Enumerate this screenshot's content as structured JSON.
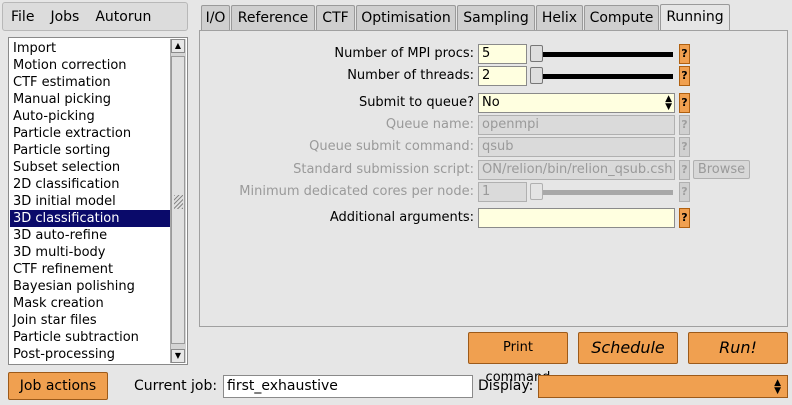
{
  "menu": {
    "file": "File",
    "jobs": "Jobs",
    "autorun": "Autorun"
  },
  "job_types": [
    "Import",
    "Motion correction",
    "CTF estimation",
    "Manual picking",
    "Auto-picking",
    "Particle extraction",
    "Particle sorting",
    "Subset selection",
    "2D classification",
    "3D initial model",
    "3D classification",
    "3D auto-refine",
    "3D multi-body",
    "CTF refinement",
    "Bayesian polishing",
    "Mask creation",
    "Join star files",
    "Particle subtraction",
    "Post-processing"
  ],
  "selected_job_type": "3D classification",
  "tabs": [
    "I/O",
    "Reference",
    "CTF",
    "Optimisation",
    "Sampling",
    "Helix",
    "Compute",
    "Running"
  ],
  "active_tab": "Running",
  "form": {
    "mpi_procs": {
      "label": "Number of MPI procs:",
      "value": "5"
    },
    "threads": {
      "label": "Number of threads:",
      "value": "2"
    },
    "submit_to_queue": {
      "label": "Submit to queue?",
      "value": "No"
    },
    "queue_name": {
      "label": "Queue name:",
      "value": "openmpi"
    },
    "queue_submit_command": {
      "label": "Queue submit command:",
      "value": "qsub"
    },
    "submission_script": {
      "label": "Standard submission script:",
      "value": "ON/relion/bin/relion_qsub.csh"
    },
    "min_dedicated_cores": {
      "label": "Minimum dedicated cores per node:",
      "value": "1"
    },
    "additional_arguments": {
      "label": "Additional arguments:",
      "value": ""
    },
    "help_label": "?",
    "browse_label": "Browse"
  },
  "actions": {
    "print_command": "Print command",
    "schedule": "Schedule",
    "run": "Run!",
    "job_actions": "Job actions"
  },
  "footer": {
    "current_job_label": "Current job:",
    "current_job_value": "first_exhaustive",
    "display_label": "Display:",
    "display_value": ""
  },
  "colors": {
    "accent_orange": "#f0a050",
    "field_yellow": "#ffffe0",
    "selection_navy": "#0a0a6a",
    "background": "#e6e6e6"
  },
  "icons": [
    "scroll-up-arrow-icon",
    "scroll-down-arrow-icon",
    "select-arrows-icon",
    "help-icon"
  ]
}
